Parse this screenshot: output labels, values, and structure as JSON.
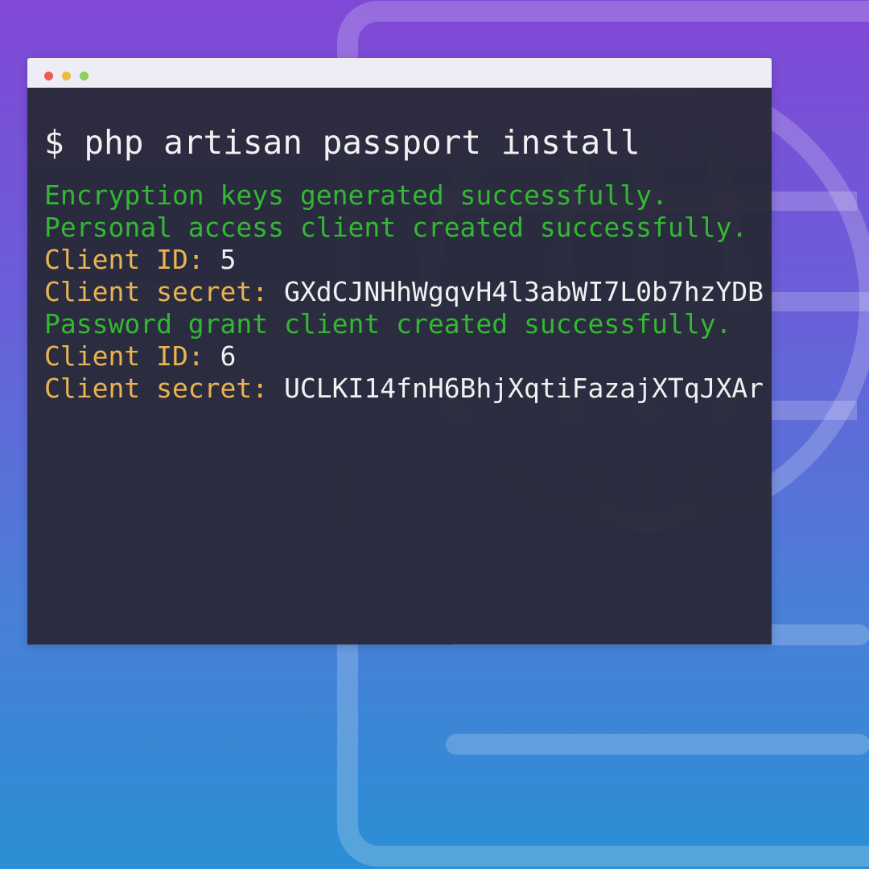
{
  "colors": {
    "background_top": "#8048d6",
    "background_bottom": "#2a8fd4",
    "terminal_bg": "#292a39",
    "titlebar_bg": "#eeecf5",
    "success_text": "#33b832",
    "key_text": "#e9b450",
    "value_text": "#f1f1f1"
  },
  "window": {
    "controls": [
      {
        "name": "close",
        "color": "#ee5a4f"
      },
      {
        "name": "minimize",
        "color": "#eebb3c"
      },
      {
        "name": "maximize",
        "color": "#8ccf5a"
      }
    ]
  },
  "terminal": {
    "command": "$ php artisan passport install",
    "output": [
      {
        "type": "success",
        "text": "Encryption keys generated successfully."
      },
      {
        "type": "success",
        "text": "Personal access client created successfully."
      },
      {
        "type": "pair",
        "key": "Client ID: ",
        "value": "5"
      },
      {
        "type": "pair",
        "key": "Client secret: ",
        "value": "GXdCJNHhWgqvH4l3abWI7L0b7hzYDB"
      },
      {
        "type": "success",
        "text": "Password grant client created successfully."
      },
      {
        "type": "pair",
        "key": "Client ID: ",
        "value": "6"
      },
      {
        "type": "pair",
        "key": "Client secret: ",
        "value": "UCLKI14fnH6BhjXqtiFazajXTqJXAr"
      }
    ]
  },
  "background_icons": [
    "card-outline-icon",
    "globe-icon"
  ]
}
